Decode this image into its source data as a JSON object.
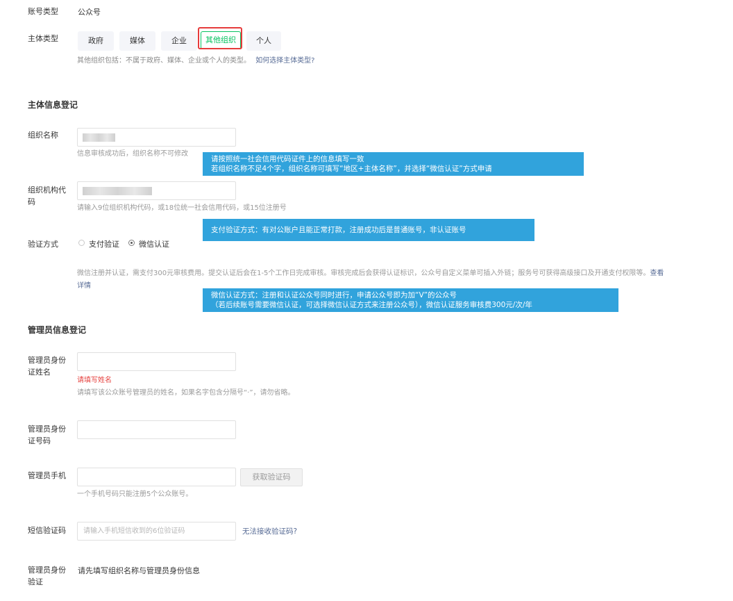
{
  "account_type": {
    "label": "账号类型",
    "value": "公众号"
  },
  "subject_type": {
    "label": "主体类型",
    "options": [
      "政府",
      "媒体",
      "企业",
      "其他组织",
      "个人"
    ],
    "selected": "其他组织",
    "description": "其他组织包括：不属于政府、媒体、企业或个人的类型。",
    "help_link": "如何选择主体类型?"
  },
  "subject_section": {
    "title": "主体信息登记"
  },
  "org_name": {
    "label": "组织名称",
    "hint": "信息审核成功后，组织名称不可修改"
  },
  "org_code": {
    "label": "组织机构代码",
    "hint": "请输入9位组织机构代码，或18位统一社会信用代码，或15位注册号"
  },
  "verify_method": {
    "label": "验证方式",
    "options": [
      "支付验证",
      "微信认证"
    ],
    "selected": "微信认证",
    "description": "微信注册并认证，需支付300元审核费用。提交认证后会在1-5个工作日完成审核。审核完成后会获得认证标识，公众号自定义菜单可插入外链；服务号可获得高级接口及开通支付权限等。",
    "detail_link_1": "查看",
    "detail_link_2": "详情"
  },
  "callouts": {
    "name_line1": "请按照统一社会信用代码证件上的信息填写一致",
    "name_line2": "若组织名称不足4个字，组织名称可填写“地区+主体名称”，并选择“微信认证”方式申请",
    "pay_line1": "支付验证方式：有对公账户且能正常打款，注册成功后是普通账号，非认证账号",
    "wechat_line1": "微信认证方式：注册和认证公众号同时进行，申请公众号即为加“V”的公众号",
    "wechat_line2": "（若后续账号需要微信认证，可选择微信认证方式来注册公众号），微信认证服务审核费300元/次/年"
  },
  "admin_section": {
    "title": "管理员信息登记"
  },
  "admin_name": {
    "label_1": "管理员身份",
    "label_2": "证姓名",
    "error": "请填写姓名",
    "hint": "请填写该公众账号管理员的姓名，如果名字包含分隔号“·”，请勿省略。"
  },
  "admin_id": {
    "label_1": "管理员身份",
    "label_2": "证号码"
  },
  "admin_phone": {
    "label": "管理员手机",
    "get_code_button": "获取验证码",
    "hint": "一个手机号码只能注册5个公众账号。"
  },
  "sms_code": {
    "label": "短信验证码",
    "placeholder": "请输入手机短信收到的6位验证码",
    "help_link": "无法接收验证码?"
  },
  "admin_verify": {
    "label_1": "管理员身份",
    "label_2": "验证",
    "value": "请先填写组织名称与管理员身份信息"
  }
}
